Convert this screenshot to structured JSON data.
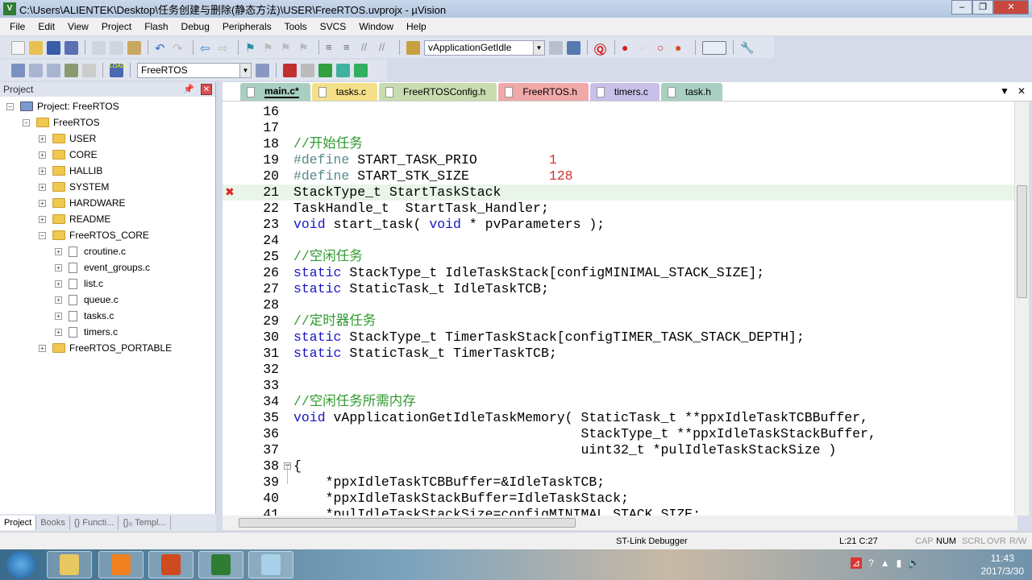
{
  "window": {
    "title": "C:\\Users\\ALIENTEK\\Desktop\\任务创建与删除(静态方法)\\USER\\FreeRTOS.uvprojx - µVision",
    "app_icon": "V5"
  },
  "menu": [
    "File",
    "Edit",
    "View",
    "Project",
    "Flash",
    "Debug",
    "Peripherals",
    "Tools",
    "SVCS",
    "Window",
    "Help"
  ],
  "toolbar": {
    "function_combo": "vApplicationGetIdle",
    "target_combo": "FreeRTOS"
  },
  "project_panel": {
    "title": "Project",
    "tree": [
      {
        "label": "Project: FreeRTOS",
        "level": 0,
        "kind": "project",
        "expander": "-"
      },
      {
        "label": "FreeRTOS",
        "level": 1,
        "kind": "target",
        "expander": "-"
      },
      {
        "label": "USER",
        "level": 2,
        "kind": "folder",
        "expander": "+"
      },
      {
        "label": "CORE",
        "level": 2,
        "kind": "folder",
        "expander": "+"
      },
      {
        "label": "HALLIB",
        "level": 2,
        "kind": "folder",
        "expander": "+"
      },
      {
        "label": "SYSTEM",
        "level": 2,
        "kind": "folder",
        "expander": "+"
      },
      {
        "label": "HARDWARE",
        "level": 2,
        "kind": "folder",
        "expander": "+"
      },
      {
        "label": "README",
        "level": 2,
        "kind": "folder",
        "expander": "+"
      },
      {
        "label": "FreeRTOS_CORE",
        "level": 2,
        "kind": "folder",
        "expander": "-"
      },
      {
        "label": "croutine.c",
        "level": 3,
        "kind": "file",
        "expander": "+"
      },
      {
        "label": "event_groups.c",
        "level": 3,
        "kind": "file",
        "expander": "+"
      },
      {
        "label": "list.c",
        "level": 3,
        "kind": "file",
        "expander": "+"
      },
      {
        "label": "queue.c",
        "level": 3,
        "kind": "file",
        "expander": "+"
      },
      {
        "label": "tasks.c",
        "level": 3,
        "kind": "file",
        "expander": "+"
      },
      {
        "label": "timers.c",
        "level": 3,
        "kind": "file",
        "expander": "+"
      },
      {
        "label": "FreeRTOS_PORTABLE",
        "level": 2,
        "kind": "folder",
        "expander": "+"
      }
    ],
    "bottom_tabs": [
      "Project",
      "Books",
      "{} Functi...",
      "{}₀ Templ..."
    ]
  },
  "editor_tabs": [
    {
      "label": "main.c*",
      "color": "#a9cfc0",
      "active": true
    },
    {
      "label": "tasks.c",
      "color": "#f5e08a"
    },
    {
      "label": "FreeRTOSConfig.h",
      "color": "#c8dcb0"
    },
    {
      "label": "FreeRTOS.h",
      "color": "#f0a8a8"
    },
    {
      "label": "timers.c",
      "color": "#c8c0e8"
    },
    {
      "label": "task.h",
      "color": "#a9cfc0"
    }
  ],
  "code": [
    {
      "n": "16",
      "seg": []
    },
    {
      "n": "17",
      "seg": []
    },
    {
      "n": "18",
      "seg": [
        [
          "comment",
          "//开始任务"
        ]
      ]
    },
    {
      "n": "19",
      "seg": [
        [
          "pp",
          "#define "
        ],
        [
          "txt",
          "START_TASK_PRIO         "
        ],
        [
          "num",
          "1"
        ]
      ]
    },
    {
      "n": "20",
      "seg": [
        [
          "pp",
          "#define "
        ],
        [
          "txt",
          "START_STK_SIZE          "
        ],
        [
          "num",
          "128"
        ]
      ]
    },
    {
      "n": "21",
      "seg": [
        [
          "txt",
          "StackType_t StartTaskStack"
        ]
      ],
      "current": true,
      "breakpoint": "error"
    },
    {
      "n": "22",
      "seg": [
        [
          "txt",
          "TaskHandle_t  StartTask_Handler;"
        ]
      ]
    },
    {
      "n": "23",
      "seg": [
        [
          "kw",
          "void"
        ],
        [
          "txt",
          " start_task( "
        ],
        [
          "kw",
          "void"
        ],
        [
          "txt",
          " * pvParameters );"
        ]
      ]
    },
    {
      "n": "24",
      "seg": []
    },
    {
      "n": "25",
      "seg": [
        [
          "comment",
          "//空闲任务"
        ]
      ]
    },
    {
      "n": "26",
      "seg": [
        [
          "kw",
          "static"
        ],
        [
          "txt",
          " StackType_t IdleTaskStack[configMINIMAL_STACK_SIZE];"
        ]
      ]
    },
    {
      "n": "27",
      "seg": [
        [
          "kw",
          "static"
        ],
        [
          "txt",
          " StaticTask_t IdleTaskTCB;"
        ]
      ]
    },
    {
      "n": "28",
      "seg": []
    },
    {
      "n": "29",
      "seg": [
        [
          "comment",
          "//定时器任务"
        ]
      ]
    },
    {
      "n": "30",
      "seg": [
        [
          "kw",
          "static"
        ],
        [
          "txt",
          " StackType_t TimerTaskStack[configTIMER_TASK_STACK_DEPTH];"
        ]
      ]
    },
    {
      "n": "31",
      "seg": [
        [
          "kw",
          "static"
        ],
        [
          "txt",
          " StaticTask_t TimerTaskTCB;"
        ]
      ]
    },
    {
      "n": "32",
      "seg": []
    },
    {
      "n": "33",
      "seg": []
    },
    {
      "n": "34",
      "seg": [
        [
          "comment",
          "//空闲任务所需内存"
        ]
      ]
    },
    {
      "n": "35",
      "seg": [
        [
          "kw",
          "void"
        ],
        [
          "txt",
          " vApplicationGetIdleTaskMemory( StaticTask_t **ppxIdleTaskTCBBuffer,"
        ]
      ]
    },
    {
      "n": "36",
      "seg": [
        [
          "txt",
          "                                    StackType_t **ppxIdleTaskStackBuffer,"
        ]
      ]
    },
    {
      "n": "37",
      "seg": [
        [
          "txt",
          "                                    uint32_t *pulIdleTaskStackSize )"
        ]
      ]
    },
    {
      "n": "38",
      "seg": [
        [
          "txt",
          "{"
        ]
      ],
      "fold": "-"
    },
    {
      "n": "39",
      "seg": [
        [
          "txt",
          "    *ppxIdleTaskTCBBuffer=&IdleTaskTCB;"
        ]
      ]
    },
    {
      "n": "40",
      "seg": [
        [
          "txt",
          "    *ppxIdleTaskStackBuffer=IdleTaskStack;"
        ]
      ]
    },
    {
      "n": "41",
      "seg": [
        [
          "txt",
          "    *pulIdleTaskStackSize=configMINIMAL_STACK_SIZE;"
        ]
      ]
    }
  ],
  "status": {
    "debugger": "ST-Link Debugger",
    "position": "L:21 C:27",
    "caps": "CAP",
    "num": "NUM",
    "scrl": "SCRL",
    "ovr": "OVR",
    "rw": "R/W"
  },
  "taskbar": {
    "time": "11:43",
    "date": "2017/3/30"
  }
}
